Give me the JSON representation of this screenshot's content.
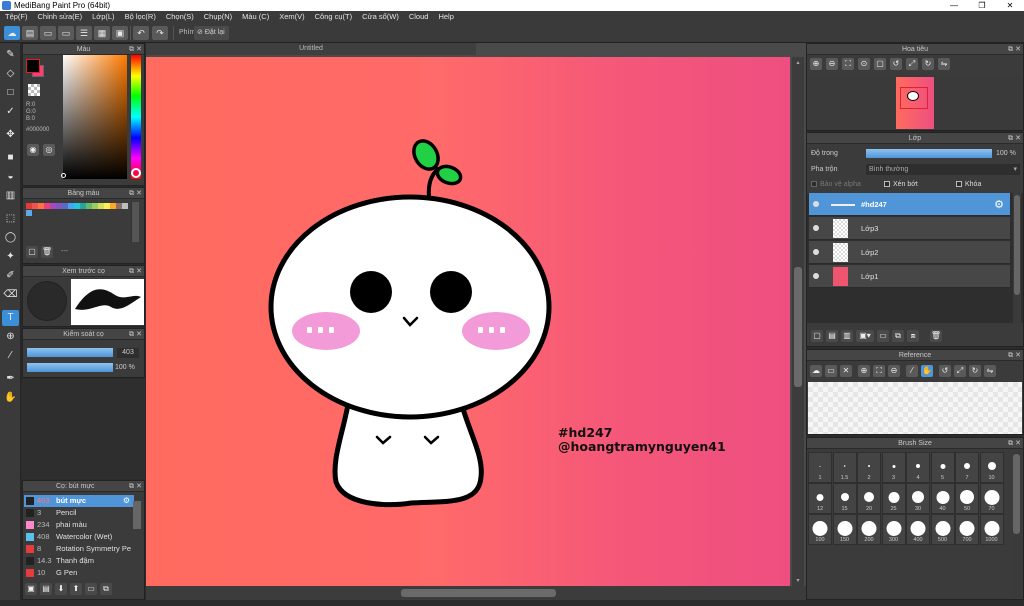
{
  "window": {
    "title": "MediBang Paint Pro (64bit)",
    "min": "—",
    "max": "❐",
    "close": "✕"
  },
  "menu": [
    "Tệp(F)",
    "Chỉnh sửa(E)",
    "Lớp(L)",
    "Bộ lọc(R)",
    "Chọn(S)",
    "Chụp(N)",
    "Màu (C)",
    "Xem(V)",
    "Công cụ(T)",
    "Cửa sổ(W)",
    "Cloud",
    "Help"
  ],
  "toolbar": {
    "hint_label": "Phím",
    "reset_label": "Đặt lại"
  },
  "color_panel": {
    "title": "Màu",
    "r": "R:0",
    "g": "G:0",
    "b": "B:0",
    "hex": "#000000"
  },
  "palette_panel": {
    "title": "Bảng màu",
    "dash": "---"
  },
  "brush_preview": {
    "title": "Xem trước cọ"
  },
  "brush_control": {
    "title": "Kiểm soát cọ",
    "size": "403",
    "opacity": "100 %"
  },
  "brush_list": {
    "title": "Cọ: bút mực",
    "items": [
      {
        "size": "403",
        "name": "bút mực",
        "color": "#222222",
        "selected": true
      },
      {
        "size": "3",
        "name": "Pencil",
        "color": "#222222"
      },
      {
        "size": "234",
        "name": "phai màu",
        "color": "#ff88cc"
      },
      {
        "size": "408",
        "name": "Watercolor (Wet)",
        "color": "#5bc0eb"
      },
      {
        "size": "8",
        "name": "Rotation Symmetry Pe",
        "color": "#e63b3b"
      },
      {
        "size": "14.3",
        "name": "Thanh đậm",
        "color": "#222222"
      },
      {
        "size": "10",
        "name": "G Pen",
        "color": "#e63b3b"
      }
    ]
  },
  "canvas": {
    "tab_title": "Untitled",
    "text_line1": "#hd247",
    "text_line2": "@hoangtramynguyen41"
  },
  "navigator": {
    "title": "Hoa tiêu"
  },
  "layers": {
    "title": "Lớp",
    "opacity_label": "Độ trong",
    "opacity_value": "100 %",
    "opacity": 1.0,
    "blend_label": "Pha trộn",
    "blend_value": "Bình thường",
    "protect_alpha": "Bảo vệ alpha",
    "clip": "Xén bớt",
    "lock": "Khóa",
    "items": [
      {
        "name": "#hd247",
        "selected": true
      },
      {
        "name": "Lớp3"
      },
      {
        "name": "Lớp2"
      },
      {
        "name": "Lớp1"
      }
    ]
  },
  "reference": {
    "title": "Reference"
  },
  "brush_size": {
    "title": "Brush Size",
    "sizes": [
      "1",
      "1.5",
      "2",
      "3",
      "4",
      "5",
      "7",
      "10",
      "12",
      "15",
      "20",
      "25",
      "30",
      "40",
      "50",
      "70",
      "100",
      "150",
      "200",
      "300",
      "400",
      "500",
      "700",
      "1000"
    ]
  },
  "colors": {
    "accent": "#4f95d8",
    "canvas_left": "#ff6b5e",
    "canvas_right": "#ee4f80"
  }
}
